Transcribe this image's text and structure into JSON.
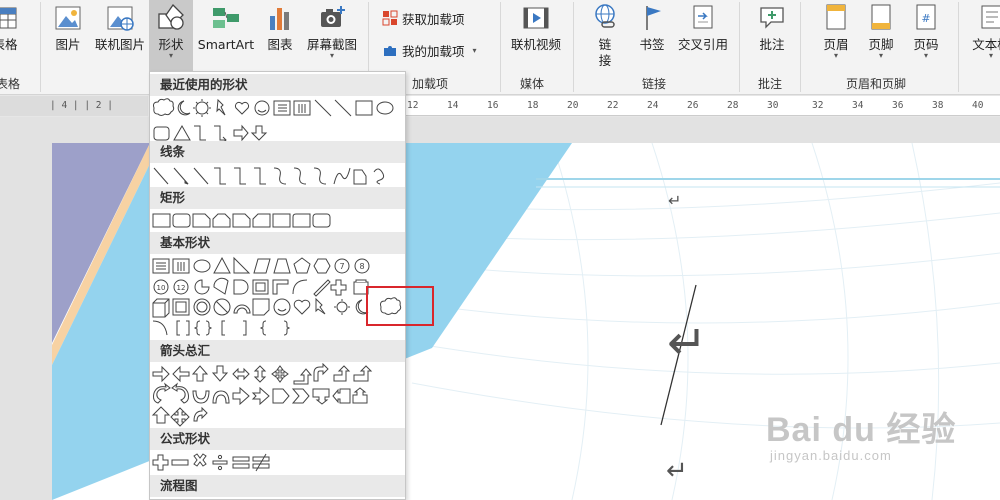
{
  "ribbon": {
    "buttons": [
      {
        "id": "table",
        "label": "表格",
        "icon": "table-icon"
      },
      {
        "id": "picture",
        "label": "图片",
        "icon": "picture-icon"
      },
      {
        "id": "online-picture",
        "label": "联机图片",
        "icon": "online-picture-icon"
      },
      {
        "id": "shapes",
        "label": "形状",
        "icon": "shapes-icon"
      },
      {
        "id": "smartart",
        "label": "SmartArt",
        "icon": "smartart-icon"
      },
      {
        "id": "chart",
        "label": "图表",
        "icon": "chart-icon"
      },
      {
        "id": "screenshot",
        "label": "屏幕截图",
        "icon": "screenshot-icon"
      },
      {
        "id": "online-video",
        "label": "联机视频",
        "icon": "online-video-icon"
      },
      {
        "id": "link",
        "label": "链\n接",
        "icon": "link-icon"
      },
      {
        "id": "bookmark",
        "label": "书签",
        "icon": "bookmark-icon"
      },
      {
        "id": "cross-ref",
        "label": "交叉引用",
        "icon": "cross-reference-icon"
      },
      {
        "id": "comment",
        "label": "批注",
        "icon": "comment-icon"
      },
      {
        "id": "header",
        "label": "页眉",
        "icon": "header-icon"
      },
      {
        "id": "footer",
        "label": "页脚",
        "icon": "footer-icon"
      },
      {
        "id": "page-number",
        "label": "页码",
        "icon": "page-number-icon"
      },
      {
        "id": "textbox",
        "label": "文本框",
        "icon": "textbox-icon"
      }
    ],
    "addins": {
      "get": "获取加载项",
      "mine": "我的加载项"
    },
    "groups": {
      "tables": "表格",
      "addins": "加载项",
      "media": "媒体",
      "links": "链接",
      "comments": "批注",
      "header_footer": "页眉和页脚"
    }
  },
  "ruler": {
    "left_ticks": "| 4 |   | 2 |",
    "ticks": [
      "12",
      "14",
      "16",
      "18",
      "20",
      "22",
      "24",
      "26",
      "28",
      "30",
      "32",
      "34",
      "36",
      "38",
      "40"
    ]
  },
  "shapes_menu": {
    "sections": {
      "recent": "最近使用的形状",
      "lines": "线条",
      "rectangles": "矩形",
      "basic": "基本形状",
      "arrows": "箭头总汇",
      "equation": "公式形状",
      "flowchart": "流程图"
    },
    "highlighted_shape": "cloud-shape"
  },
  "document": {
    "return_mark": "↵"
  },
  "watermark": {
    "main": "Bai du 经验",
    "sub": "jingyan.baidu.com"
  },
  "colors": {
    "accent_blue": "#94d3ee",
    "purple_panel": "#9da0c9",
    "peach_stripe": "#f7d2a3",
    "highlight_red": "#d9262c"
  }
}
